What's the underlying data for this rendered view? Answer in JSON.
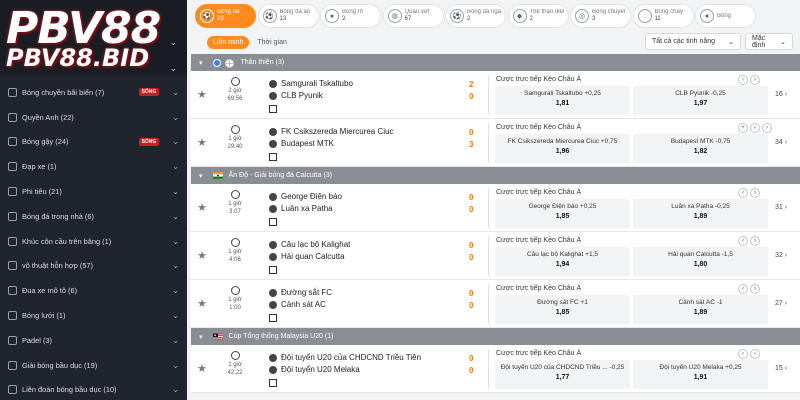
{
  "brand": {
    "logo_main": "PBV88",
    "logo_sub": "PBV88.BID"
  },
  "sidebar": {
    "items": [
      {
        "name": "Bóng chuyền bãi biển (7)",
        "live": "SỐNG"
      },
      {
        "name": "Quyền Anh (22)",
        "live": ""
      },
      {
        "name": "Bóng gậy (24)",
        "live": "SỐNG"
      },
      {
        "name": "Đạp xe (1)",
        "live": ""
      },
      {
        "name": "Phi tiêu (21)",
        "live": ""
      },
      {
        "name": "Bóng đá trong nhà (6)",
        "live": ""
      },
      {
        "name": "Khúc côn cầu trên băng (1)",
        "live": ""
      },
      {
        "name": "võ thuật hỗn hợp (57)",
        "live": ""
      },
      {
        "name": "Đua xe mô tô (6)",
        "live": ""
      },
      {
        "name": "Bóng lưới (1)",
        "live": ""
      },
      {
        "name": "Padel (3)",
        "live": ""
      },
      {
        "name": "Giải bóng bầu dục (19)",
        "live": ""
      },
      {
        "name": "Liên đoàn bóng bầu dục (10)",
        "live": ""
      }
    ]
  },
  "sport_tabs": [
    {
      "name": "Bóng đá",
      "count": "29",
      "icon": "soccer-ball-icon",
      "glyph": "⚽"
    },
    {
      "name": "Bóng đá ảo",
      "count": "13",
      "icon": "virtual-soccer-icon",
      "glyph": "⚽"
    },
    {
      "name": "Bóng rổ",
      "count": "2",
      "icon": "basketball-icon",
      "glyph": "●"
    },
    {
      "name": "Quần vợt",
      "count": "67",
      "icon": "tennis-icon",
      "glyph": "◍"
    },
    {
      "name": "Bóng đá ngắn",
      "count": "2",
      "icon": "short-soccer-icon",
      "glyph": "⚽"
    },
    {
      "name": "Thể thao điện tử",
      "count": "2",
      "icon": "esports-icon",
      "glyph": "◆"
    },
    {
      "name": "Bóng chuyền",
      "count": "3",
      "icon": "volleyball-icon",
      "glyph": "◎"
    },
    {
      "name": "Bóng chày",
      "count": "11",
      "icon": "baseball-icon",
      "glyph": "◌"
    },
    {
      "name": "Bóng",
      "count": "",
      "icon": "ball-icon",
      "glyph": "●"
    }
  ],
  "filters": {
    "time_tabs": [
      "Liên minh",
      "Thời gian"
    ],
    "region_select": "Tất cả các tỉnh năng",
    "default_select": "Mặc định"
  },
  "leagues": [
    {
      "name": "Thân thiện (3)",
      "flag": "world",
      "matches": [
        {
          "period": "2 giờ",
          "clock": "69:56",
          "home": "Samgurali Tskaltubo",
          "away": "CLB Pyunik",
          "home_score": "2",
          "away_score": "0",
          "market": "Cược trực tiếp Kèo Châu Á",
          "odds1_label": "Samgurali Tskaltubo  +0,25",
          "odds1_value": "1,81",
          "odds2_label": "CLB Pyunik   -0,25",
          "odds2_value": "1,97",
          "more": "16",
          "nav": [
            "‹",
            "›"
          ]
        },
        {
          "period": "1 giờ",
          "clock": "29:40",
          "home": "FK Csikszereda Miercurea Ciuc",
          "away": "Budapest MTK",
          "home_score": "0",
          "away_score": "3",
          "market": "Cược trực tiếp Kèo Châu Á",
          "odds1_label": "FK Csikszereda Miercurea Ciuc  +0,75",
          "odds1_value": "1,96",
          "odds2_label": "Budapest MTK   -0,75",
          "odds2_value": "1,82",
          "more": "34",
          "nav": [
            "+",
            "‹",
            "›"
          ]
        }
      ]
    },
    {
      "name": "Ấn Độ - Giải bóng đá Calcutta (3)",
      "flag": "india",
      "matches": [
        {
          "period": "1 giờ",
          "clock": "3:07",
          "home": "George Điện báo",
          "away": "Luân xa Patha",
          "home_score": "0",
          "away_score": "0",
          "market": "Cược trực tiếp Kèo Châu Á",
          "odds1_label": "George Điện báo  +0,25",
          "odds1_value": "1,85",
          "odds2_label": "Luân xa Patha   -0,25",
          "odds2_value": "1,89",
          "more": "31",
          "nav": [
            "‹",
            "›"
          ]
        },
        {
          "period": "1 giờ",
          "clock": "4:06",
          "home": "Câu lạc bộ Kalighat",
          "away": "Hải quan Calcutta",
          "home_score": "0",
          "away_score": "0",
          "market": "Cược trực tiếp Kèo Châu Á",
          "odds1_label": "Câu lạc bộ Kalighat  +1,5",
          "odds1_value": "1,94",
          "odds2_label": "Hải quan Calcutta   -1,5",
          "odds2_value": "1,80",
          "more": "32",
          "nav": [
            "‹",
            "›"
          ]
        },
        {
          "period": "1 giờ",
          "clock": "1:00",
          "home": "Đường sắt FC",
          "away": "Cảnh sát AC",
          "home_score": "0",
          "away_score": "0",
          "market": "Cược trực tiếp Kèo Châu Á",
          "odds1_label": "Đường sắt FC  +1",
          "odds1_value": "1,85",
          "odds2_label": "Cảnh sát AC   -1",
          "odds2_value": "1,89",
          "more": "27",
          "nav": [
            "‹",
            "›"
          ]
        }
      ]
    },
    {
      "name": "Cúp Tổng thống Malaysia U20 (1)",
      "flag": "malaysia",
      "matches": [
        {
          "period": "1 giờ",
          "clock": "42:22",
          "home": "Đội tuyển U20 của CHDCND Triều Tiên",
          "away": "Đội tuyển U20 Melaka",
          "home_score": "0",
          "away_score": "0",
          "market": "Cược trực tiếp Kèo Châu Á",
          "odds1_label": "Đội tuyển U20 của CHDCND Triều ...  -0,25",
          "odds1_value": "1,77",
          "odds2_label": "Đội tuyển U20 Melaka   +0,25",
          "odds2_value": "1,91",
          "more": "15",
          "nav": [
            "‹",
            "›"
          ]
        }
      ]
    }
  ],
  "colors": {
    "accent": "#ff8a1e",
    "sidebar_bg": "#20242c",
    "league_bg": "#8a8d93",
    "live_badge": "#c91f1f",
    "score": "#f07c1a"
  }
}
